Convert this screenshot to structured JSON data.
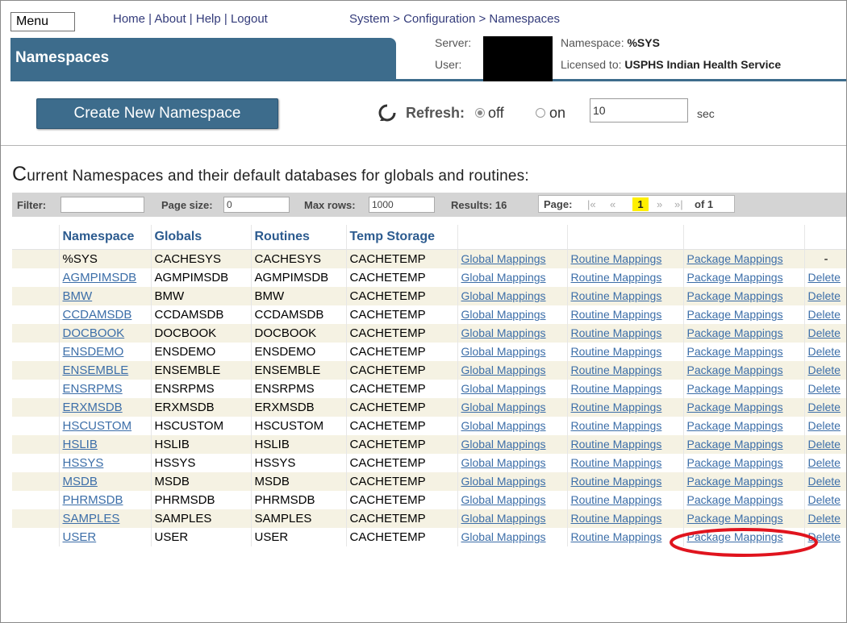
{
  "header": {
    "menu_label": "Menu",
    "links": [
      "Home",
      "About",
      "Help",
      "Logout"
    ],
    "link_sep": " | ",
    "breadcrumb": "System > Configuration > Namespaces",
    "page_title": "Namespaces",
    "server_label": "Server:",
    "user_label": "User:",
    "namespace_label": "Namespace:",
    "namespace_value": "%SYS",
    "licensed_label": "Licensed to:",
    "licensed_value": "USPHS Indian Health Service"
  },
  "toolbar": {
    "create_button": "Create New Namespace",
    "refresh_label": "Refresh:",
    "refresh_off": "off",
    "refresh_on": "on",
    "refresh_value": "10",
    "refresh_unit": "sec",
    "refresh_selected": "off"
  },
  "heading": {
    "first_letter": "C",
    "rest": "urrent Namespaces and their default databases for globals and routines:"
  },
  "filter": {
    "filter_label": "Filter:",
    "filter_value": "",
    "page_size_label": "Page size:",
    "page_size_value": "0",
    "max_rows_label": "Max rows:",
    "max_rows_value": "1000",
    "results_label": "Results: 16",
    "page_label": "Page:",
    "first": "|«",
    "prev": "«",
    "current_page": "1",
    "next": "»",
    "last": "»|",
    "of_label": "of 1"
  },
  "table": {
    "columns": [
      "Namespace",
      "Globals",
      "Routines",
      "Temp Storage"
    ],
    "link_labels": {
      "global": "Global Mappings",
      "routine": "Routine Mappings",
      "package": "Package Mappings",
      "delete": "Delete",
      "no_delete": "-"
    },
    "rows": [
      {
        "ns": "%SYS",
        "globals": "CACHESYS",
        "routines": "CACHESYS",
        "temp": "CACHETEMP"
      },
      {
        "ns": "AGMPIMSDB",
        "globals": "AGMPIMSDB",
        "routines": "AGMPIMSDB",
        "temp": "CACHETEMP"
      },
      {
        "ns": "BMW",
        "globals": "BMW",
        "routines": "BMW",
        "temp": "CACHETEMP"
      },
      {
        "ns": "CCDAMSDB",
        "globals": "CCDAMSDB",
        "routines": "CCDAMSDB",
        "temp": "CACHETEMP"
      },
      {
        "ns": "DOCBOOK",
        "globals": "DOCBOOK",
        "routines": "DOCBOOK",
        "temp": "CACHETEMP"
      },
      {
        "ns": "ENSDEMO",
        "globals": "ENSDEMO",
        "routines": "ENSDEMO",
        "temp": "CACHETEMP"
      },
      {
        "ns": "ENSEMBLE",
        "globals": "ENSEMBLE",
        "routines": "ENSEMBLE",
        "temp": "CACHETEMP"
      },
      {
        "ns": "ENSRPMS",
        "globals": "ENSRPMS",
        "routines": "ENSRPMS",
        "temp": "CACHETEMP"
      },
      {
        "ns": "ERXMSDB",
        "globals": "ERXMSDB",
        "routines": "ERXMSDB",
        "temp": "CACHETEMP"
      },
      {
        "ns": "HSCUSTOM",
        "globals": "HSCUSTOM",
        "routines": "HSCUSTOM",
        "temp": "CACHETEMP"
      },
      {
        "ns": "HSLIB",
        "globals": "HSLIB",
        "routines": "HSLIB",
        "temp": "CACHETEMP"
      },
      {
        "ns": "HSSYS",
        "globals": "HSSYS",
        "routines": "HSSYS",
        "temp": "CACHETEMP"
      },
      {
        "ns": "MSDB",
        "globals": "MSDB",
        "routines": "MSDB",
        "temp": "CACHETEMP"
      },
      {
        "ns": "PHRMSDB",
        "globals": "PHRMSDB",
        "routines": "PHRMSDB",
        "temp": "CACHETEMP"
      },
      {
        "ns": "SAMPLES",
        "globals": "SAMPLES",
        "routines": "SAMPLES",
        "temp": "CACHETEMP"
      },
      {
        "ns": "USER",
        "globals": "USER",
        "routines": "USER",
        "temp": "CACHETEMP"
      }
    ]
  },
  "colors": {
    "header_blue": "#3d6c8c",
    "link_blue": "#3c6ea8",
    "row_stripe": "#f5f2e3",
    "annotation_red": "#e0141e"
  }
}
